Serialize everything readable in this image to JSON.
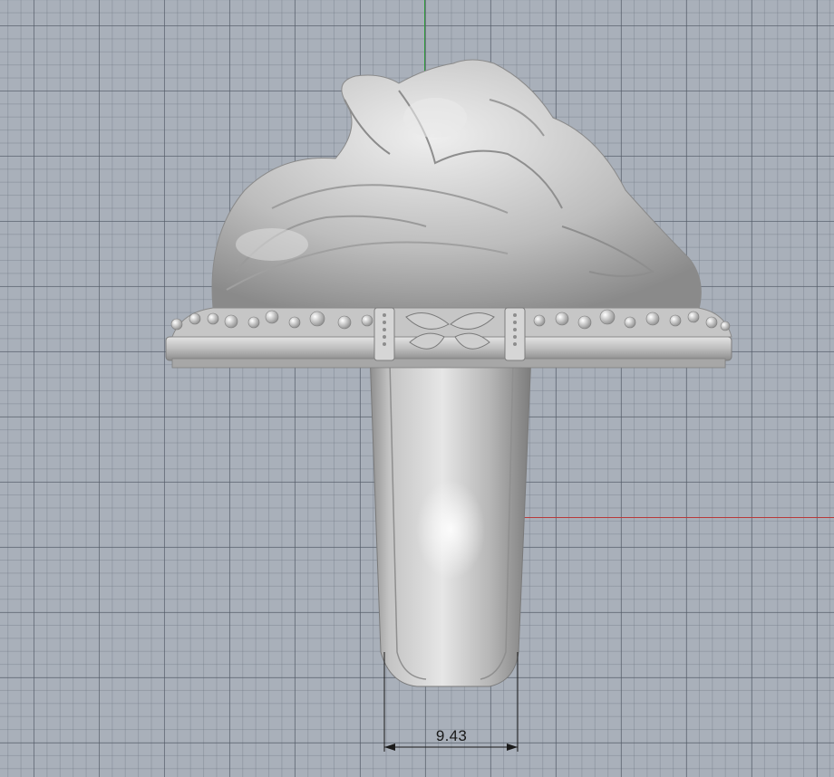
{
  "viewport": {
    "background": "#a9b0ba",
    "grid_color": "#5a626e",
    "axis_x_color": "#b83a3a",
    "axis_y_color": "#2f9a3a"
  },
  "model": {
    "name_icon": "ring-3d-model",
    "metal_color": "#c9c9c9"
  },
  "dimension": {
    "value": "9.43",
    "line_color": "#1a1a1a"
  }
}
